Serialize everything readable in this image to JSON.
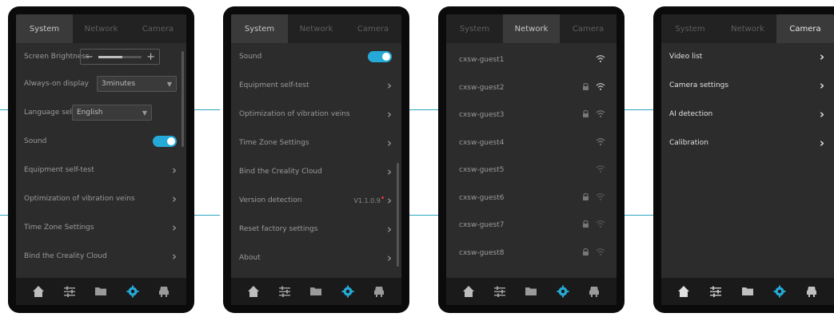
{
  "colors": {
    "accent": "#25a9d6",
    "connector": "#29a6bf",
    "badge": "#e0334a"
  },
  "tabs": {
    "system": "System",
    "network": "Network",
    "camera": "Camera"
  },
  "screen1": {
    "brightness_label": "Screen Brightness",
    "brightness_minus": "−",
    "brightness_plus": "+",
    "brightness_level": 0.55,
    "always_on_label": "Always-on display",
    "always_on_value": "3minutes",
    "language_label": "Language selection",
    "language_value": "English",
    "sound_label": "Sound",
    "self_test_label": "Equipment self-test",
    "vibration_label": "Optimization of vibration veins",
    "timezone_label": "Time Zone Settings",
    "cloud_label": "Bind the Creality Cloud"
  },
  "screen2": {
    "sound_label": "Sound",
    "self_test_label": "Equipment self-test",
    "vibration_label": "Optimization of vibration veins",
    "timezone_label": "Time Zone Settings",
    "cloud_label": "Bind the Creality Cloud",
    "version_label": "Version detection",
    "version_value": "V1.1.0.9",
    "reset_label": "Reset factory settings",
    "about_label": "About"
  },
  "screen3": {
    "networks": [
      {
        "ssid": "cxsw-guest1",
        "locked": false,
        "signal": "strong"
      },
      {
        "ssid": "cxsw-guest2",
        "locked": true,
        "signal": "strong"
      },
      {
        "ssid": "cxsw-guest3",
        "locked": true,
        "signal": "medium"
      },
      {
        "ssid": "cxsw-guest4",
        "locked": false,
        "signal": "medium"
      },
      {
        "ssid": "cxsw-guest5",
        "locked": false,
        "signal": "weak"
      },
      {
        "ssid": "cxsw-guest6",
        "locked": true,
        "signal": "weak"
      },
      {
        "ssid": "cxsw-guest7",
        "locked": true,
        "signal": "weak"
      },
      {
        "ssid": "cxsw-guest8",
        "locked": true,
        "signal": "weak"
      }
    ]
  },
  "screen4": {
    "video_list": "Video list",
    "camera_settings": "Camera settings",
    "ai_detection": "AI detection",
    "calibration": "Calibration"
  },
  "nav": [
    "home-icon",
    "sliders-icon",
    "folder-icon",
    "gear-icon",
    "printer-icon"
  ]
}
